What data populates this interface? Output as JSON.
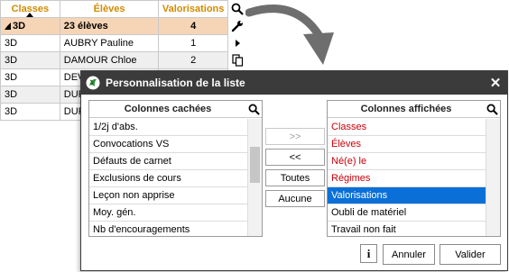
{
  "grid": {
    "headers": {
      "classes": "Classes",
      "eleves": "Élèves",
      "valorisations": "Valorisations"
    },
    "summary": {
      "classe": "3D",
      "eleves": "23 élèves",
      "valorisations": "4"
    },
    "rows": [
      {
        "classe": "3D",
        "eleve": "AUBRY Pauline",
        "valorisations": "1"
      },
      {
        "classe": "3D",
        "eleve": "DAMOUR Chloe",
        "valorisations": "2"
      },
      {
        "classe": "3D",
        "eleve": "DEV",
        "valorisations": ""
      },
      {
        "classe": "3D",
        "eleve": "DUF",
        "valorisations": ""
      },
      {
        "classe": "3D",
        "eleve": "DUF",
        "valorisations": ""
      }
    ]
  },
  "side_tools": [
    "search-icon",
    "wrench-icon",
    "play-icon",
    "copy-icon"
  ],
  "dialog": {
    "title": "Personnalisation de la liste",
    "close_label": "✕",
    "hidden_columns": {
      "header": "Colonnes cachées",
      "items": [
        "1/2j d'abs.",
        "Convocations VS",
        "Défauts de carnet",
        "Exclusions de cours",
        "Leçon non apprise",
        "Moy. gén.",
        "Nb d'encouragements"
      ]
    },
    "shown_columns": {
      "header": "Colonnes affichées",
      "items": [
        {
          "label": "Classes",
          "locked": true
        },
        {
          "label": "Élèves",
          "locked": true
        },
        {
          "label": "Né(e) le",
          "locked": true
        },
        {
          "label": "Régimes",
          "locked": true
        },
        {
          "label": "Valorisations",
          "selected": true
        },
        {
          "label": "Oubli de matériel"
        },
        {
          "label": "Travail non fait"
        }
      ]
    },
    "buttons": {
      "move_right": ">>",
      "move_left": "<<",
      "all": "Toutes",
      "none": "Aucune",
      "info": "i",
      "cancel": "Annuler",
      "ok": "Valider"
    },
    "colors": {
      "titlebar": "#3b3b3b",
      "locked_text": "#c8000a",
      "selection": "#0a70d8",
      "header_accent": "#d28a00",
      "summary_row": "#f6d5b6"
    }
  }
}
